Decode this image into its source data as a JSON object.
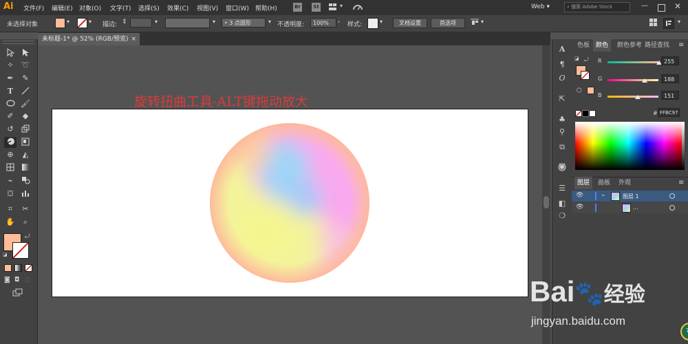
{
  "app": {
    "logo": "Ai",
    "workspace": "Web",
    "search_placeholder": "搜索 Adobe Stock"
  },
  "menu": [
    "文件(F)",
    "编辑(E)",
    "对象(O)",
    "文字(T)",
    "选择(S)",
    "效果(C)",
    "视图(V)",
    "窗口(W)",
    "帮助(H)"
  ],
  "menu_badges": {
    "bridge": "Br",
    "stock": "St"
  },
  "control": {
    "selection_label": "未选择对象",
    "stroke_label": "描边:",
    "brush_label": "3 点圆形",
    "opacity_label": "不透明度:",
    "opacity_value": "100%",
    "style_label": "样式:",
    "doc_setup": "文档设置",
    "preferences": "首选项"
  },
  "document": {
    "tab_title": "未标题-1* @ 52% (RGB/预览)",
    "close": "×"
  },
  "annotation": "旋转扭曲工具-ALT键拖动放大",
  "colors": {
    "fill": "#FFBC97",
    "accent": "#3a6a9a"
  },
  "color_panel": {
    "tabs": [
      "色板",
      "颜色",
      "颜色参考",
      "路径查找"
    ],
    "active_tab": 1,
    "channels": [
      {
        "label": "R",
        "value": "255",
        "fraction": 1.0
      },
      {
        "label": "G",
        "value": "188",
        "fraction": 0.737
      },
      {
        "label": "B",
        "value": "151",
        "fraction": 0.592
      }
    ],
    "hex": "FFBC97"
  },
  "layers_panel": {
    "tabs": [
      "图层",
      "画板",
      "外观"
    ],
    "active_tab": 0,
    "rows": [
      {
        "name": "图层 1"
      },
      {
        "name": "..."
      }
    ]
  },
  "watermark": {
    "brand": "Bai",
    "brand_suffix": "经验",
    "url": "jingyan.baidu.com",
    "badge": "78"
  }
}
